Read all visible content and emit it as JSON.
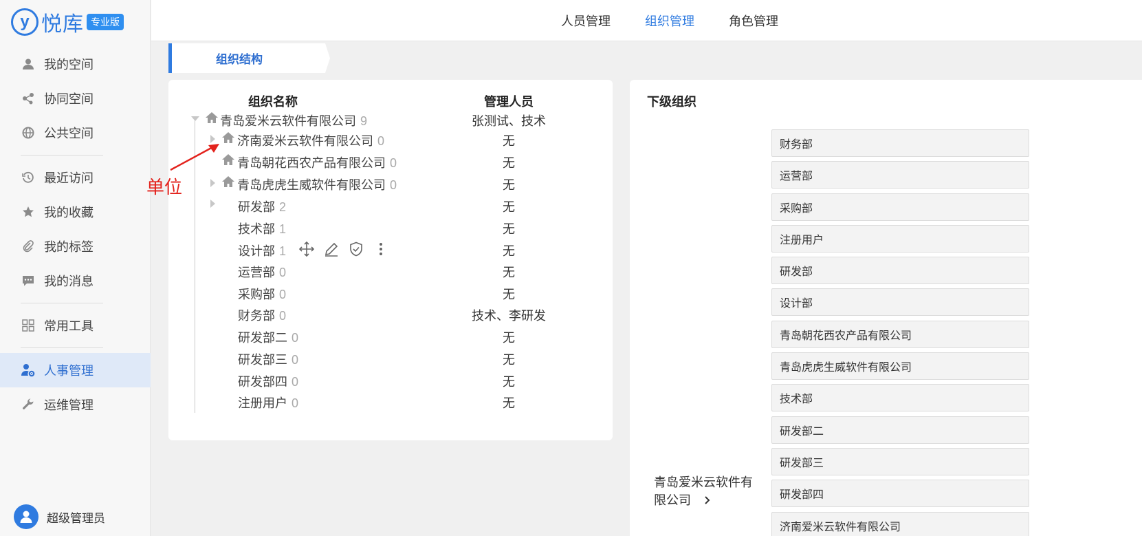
{
  "app": {
    "logo_mark": "y",
    "logo_text": "悦库",
    "edition_badge": "专业版"
  },
  "sidebar": {
    "items": [
      {
        "label": "我的空间",
        "icon": "user-icon"
      },
      {
        "label": "协同空间",
        "icon": "share-nodes-icon"
      },
      {
        "label": "公共空间",
        "icon": "globe-icon"
      },
      {
        "label": "最近访问",
        "icon": "history-icon"
      },
      {
        "label": "我的收藏",
        "icon": "star-icon"
      },
      {
        "label": "我的标签",
        "icon": "paperclip-icon"
      },
      {
        "label": "我的消息",
        "icon": "message-icon"
      },
      {
        "label": "常用工具",
        "icon": "grid-icon"
      },
      {
        "label": "人事管理",
        "icon": "user-gear-icon",
        "active": true
      },
      {
        "label": "运维管理",
        "icon": "wrench-icon"
      }
    ],
    "user_name": "超级管理员"
  },
  "topbar": {
    "tabs": [
      {
        "label": "人员管理"
      },
      {
        "label": "组织管理",
        "active": true
      },
      {
        "label": "角色管理"
      }
    ]
  },
  "breadcrumb": {
    "label": "组织结构"
  },
  "tree": {
    "col_name": "组织名称",
    "col_manager": "管理人员",
    "rows": [
      {
        "name": "青岛爱米云软件有限公司",
        "count": "9",
        "manager": "张测试、技术"
      },
      {
        "name": "济南爱米云软件有限公司",
        "count": "0",
        "manager": "无"
      },
      {
        "name": "青岛朝花西农产品有限公司",
        "count": "0",
        "manager": "无"
      },
      {
        "name": "青岛虎虎生威软件有限公司",
        "count": "0",
        "manager": "无"
      },
      {
        "name": "研发部",
        "count": "2",
        "manager": "无"
      },
      {
        "name": "技术部",
        "count": "1",
        "manager": "无"
      },
      {
        "name": "设计部",
        "count": "1",
        "manager": "无"
      },
      {
        "name": "运营部",
        "count": "0",
        "manager": "无"
      },
      {
        "name": "采购部",
        "count": "0",
        "manager": "无"
      },
      {
        "name": "财务部",
        "count": "0",
        "manager": "技术、李研发"
      },
      {
        "name": "研发部二",
        "count": "0",
        "manager": "无"
      },
      {
        "name": "研发部三",
        "count": "0",
        "manager": "无"
      },
      {
        "name": "研发部四",
        "count": "0",
        "manager": "无"
      },
      {
        "name": "注册用户",
        "count": "0",
        "manager": "无"
      }
    ]
  },
  "annotation": {
    "label": "单位",
    "color": "#e3221c"
  },
  "sub_orgs": {
    "title": "下级组织",
    "root_name": "青岛爱米云软件有限公司",
    "items": [
      "财务部",
      "运营部",
      "采购部",
      "注册用户",
      "研发部",
      "设计部",
      "青岛朝花西农产品有限公司",
      "青岛虎虎生威软件有限公司",
      "技术部",
      "研发部二",
      "研发部三",
      "研发部四",
      "济南爱米云软件有限公司"
    ]
  },
  "colors": {
    "accent": "#2f7be0",
    "active_bg": "#dfe9f8"
  }
}
